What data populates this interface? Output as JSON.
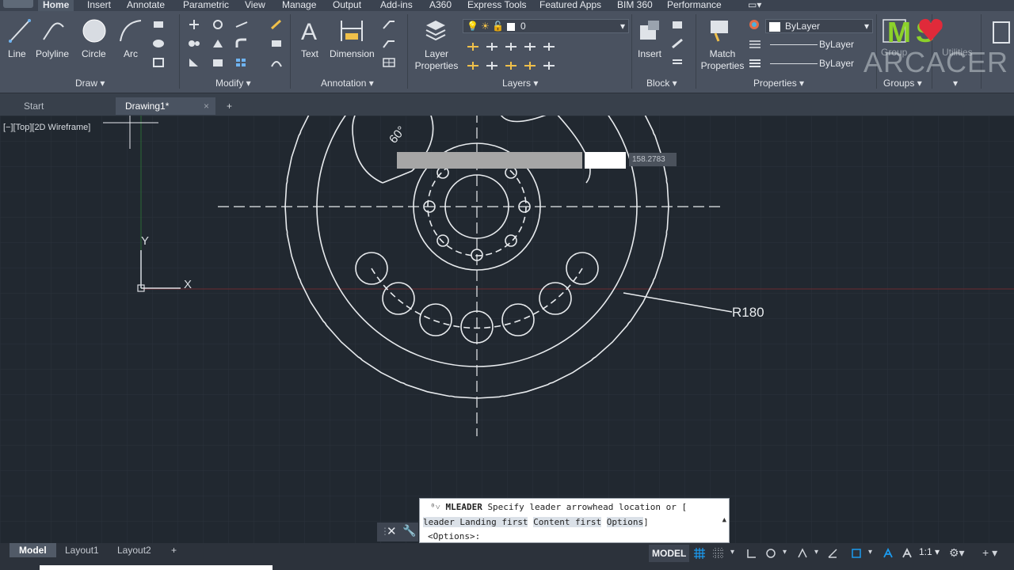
{
  "ribbon_tabs": [
    "Home",
    "Insert",
    "Annotate",
    "Parametric",
    "View",
    "Manage",
    "Output",
    "Add-ins",
    "A360",
    "Express Tools",
    "Featured Apps",
    "BIM 360",
    "Performance"
  ],
  "draw_panel": {
    "title": "Draw",
    "tools": [
      "Line",
      "Polyline",
      "Circle",
      "Arc"
    ]
  },
  "modify_panel": {
    "title": "Modify"
  },
  "annotation_panel": {
    "title": "Annotation",
    "tools": [
      "Text",
      "Dimension"
    ]
  },
  "layers_panel": {
    "title": "Layers",
    "tool": "Layer Properties",
    "current_layer": "0"
  },
  "block_panel": {
    "title": "Block",
    "tool": "Insert"
  },
  "properties_panel": {
    "title": "Properties",
    "tool": "Match Properties",
    "color": "ByLayer",
    "linetype": "ByLayer",
    "lineweight": "ByLayer"
  },
  "groups_panel": {
    "title": "Groups",
    "group_label": "Group",
    "utilities_label": "Utilities"
  },
  "watermark": {
    "text": "ARCACER",
    "badge": "MS"
  },
  "file_tabs": {
    "start": "Start",
    "drawing": "Drawing1*"
  },
  "viewport": {
    "label": "[−][Top][2D Wireframe]",
    "angle_label": "60°",
    "radius_label": "R180",
    "dynamic_input_value": "158.2783",
    "ucs_x": "X",
    "ucs_y": "Y"
  },
  "command_line": {
    "command": "MLEADER",
    "prompt": "Specify leader arrowhead location or [",
    "options": [
      "leader Landing first",
      "Content first",
      "Options"
    ],
    "closing": "]",
    "default": "<Options>:"
  },
  "layout_tabs": [
    "Model",
    "Layout1",
    "Layout2"
  ],
  "status_bar": {
    "space": "MODEL",
    "scale": "1:1"
  },
  "colors": {
    "ribbon": "#4a5260",
    "canvas": "#212830",
    "accent": "#1b9bf0"
  }
}
